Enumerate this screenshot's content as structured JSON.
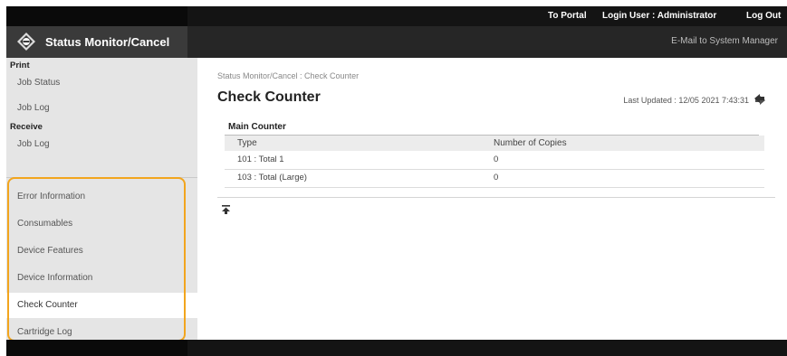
{
  "topbar": {
    "portal_link": "To Portal",
    "login_user": "Login User :  Administrator",
    "logout": "Log Out"
  },
  "header": {
    "title": "Status Monitor/Cancel",
    "mail_link": "E-Mail to System Manager",
    "icon": "status-monitor-icon"
  },
  "sidebar": {
    "groups": [
      {
        "label": "Print",
        "items": [
          "Job Status",
          "Job Log"
        ]
      },
      {
        "label": "Receive",
        "items": [
          "Job Log"
        ]
      }
    ],
    "items": [
      "Error Information",
      "Consumables",
      "Device Features",
      "Device Information",
      "Check Counter",
      "Cartridge Log"
    ],
    "active_item": "Check Counter",
    "highlight_color": "#f2a51e"
  },
  "main": {
    "breadcrumb": "Status Monitor/Cancel : Check Counter",
    "title": "Check Counter",
    "last_updated": "Last Updated : 12/05 2021 7:43:31",
    "refresh_icon": "refresh-icon",
    "section_title": "Main Counter",
    "columns": [
      "Type",
      "Number of Copies"
    ],
    "rows": [
      [
        "101 : Total 1",
        "0"
      ],
      [
        "103 : Total (Large)",
        "0"
      ]
    ],
    "top_icon": "back-to-top-icon"
  }
}
